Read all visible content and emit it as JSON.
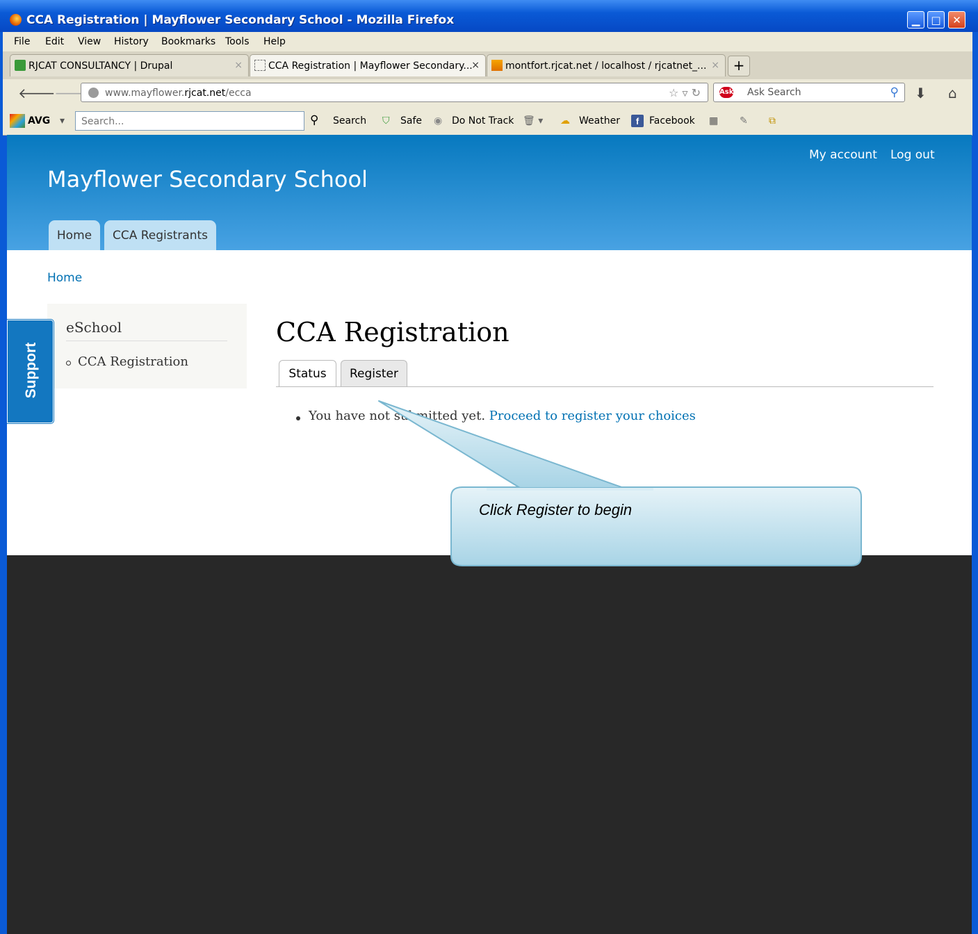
{
  "window": {
    "title": "CCA Registration | Mayflower Secondary School - Mozilla Firefox"
  },
  "menu": [
    "File",
    "Edit",
    "View",
    "History",
    "Bookmarks",
    "Tools",
    "Help"
  ],
  "tabs": [
    {
      "label": "RJCAT CONSULTANCY | Drupal",
      "close": "×"
    },
    {
      "label": "CCA Registration | Mayflower Secondary...",
      "close": "×"
    },
    {
      "label": "montfort.rjcat.net / localhost / rjcatnet_...",
      "close": "×"
    }
  ],
  "new_tab": "+",
  "address": {
    "prefix": "www.mayflower.",
    "domain": "rjcat.net",
    "path": "/ecca"
  },
  "ask": {
    "placeholder": "Ask Search",
    "logo": "Ask"
  },
  "avg": {
    "brand": "AVG",
    "search_placeholder": "Search...",
    "search_button": "Search",
    "safe": "Safe",
    "dnt": "Do Not Track",
    "weather": "Weather",
    "facebook": "Facebook"
  },
  "site": {
    "name": "Mayflower Secondary School",
    "account": "My account",
    "logout": "Log out",
    "primary_tabs": [
      "Home",
      "CCA Registrants"
    ],
    "breadcrumb": "Home",
    "sidebar": {
      "title": "eSchool",
      "items": [
        "CCA Registration"
      ]
    },
    "support": "Support",
    "page_title": "CCA Registration",
    "subtabs": [
      "Status",
      "Register"
    ],
    "message": "You have not submitted yet.",
    "message_link": "Proceed to register your choices"
  },
  "callout": "Click Register to begin"
}
